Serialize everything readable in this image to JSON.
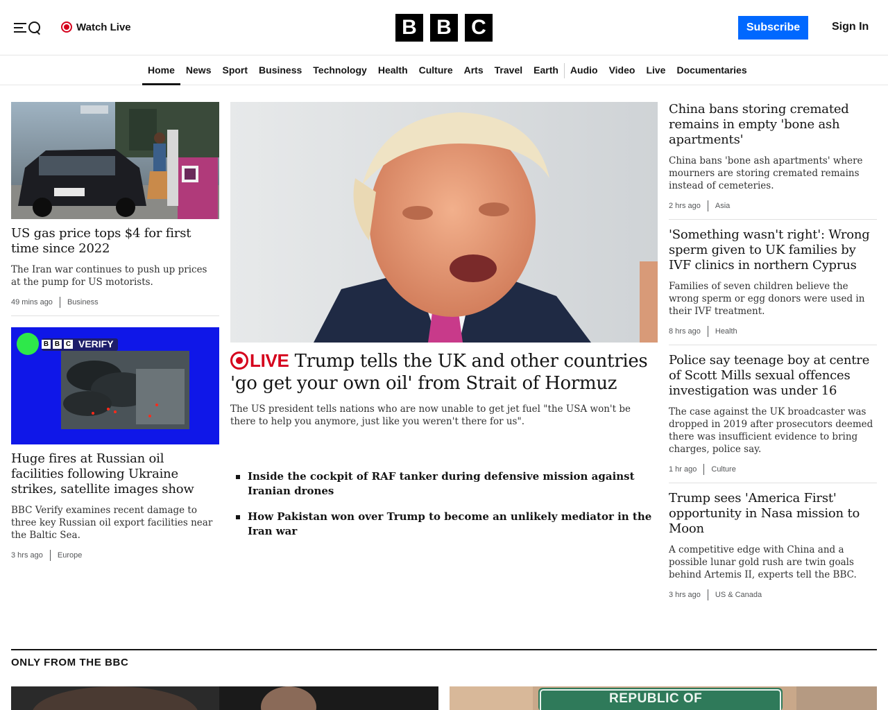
{
  "header": {
    "watch_live": "Watch Live",
    "logo": [
      "B",
      "B",
      "C"
    ],
    "subscribe": "Subscribe",
    "sign_in": "Sign In",
    "accent": "#0068ff",
    "live_color": "#d5001c"
  },
  "nav": {
    "items": [
      "Home",
      "News",
      "Sport",
      "Business",
      "Technology",
      "Health",
      "Culture",
      "Arts",
      "Travel",
      "Earth",
      "Audio",
      "Video",
      "Live",
      "Documentaries"
    ],
    "active": "Home"
  },
  "left": [
    {
      "title": "US gas price tops $4 for first time since 2022",
      "desc": "The Iran war continues to push up prices at the pump for US motorists.",
      "time": "49 mins ago",
      "tag": "Business"
    },
    {
      "title": "Huge fires at Russian oil facilities following Ukraine strikes, satellite images show",
      "desc": "BBC Verify examines recent damage to three key Russian oil export facilities near the Baltic Sea.",
      "time": "3 hrs ago",
      "tag": "Europe",
      "badge": "VERIFY"
    }
  ],
  "hero": {
    "live_label": "LIVE",
    "title": "Trump tells the UK and other countries 'go get your own oil' from Strait of Hormuz",
    "desc": "The US president tells nations who are now unable to get jet fuel \"the USA won't be there to help you anymore, just like you weren't there for us\".",
    "related": [
      "Inside the cockpit of RAF tanker during defensive mission against Iranian drones",
      "How Pakistan won over Trump to become an unlikely mediator in the Iran war"
    ]
  },
  "right": [
    {
      "title": "China bans storing cremated remains in empty 'bone ash apartments'",
      "desc": "China bans 'bone ash apartments' where mourners are storing cremated remains instead of cemeteries.",
      "time": "2 hrs ago",
      "tag": "Asia"
    },
    {
      "title": "'Something wasn't right': Wrong sperm given to UK families by IVF clinics in northern Cyprus",
      "desc": "Families of seven children believe the wrong sperm or egg donors were used in their IVF treatment.",
      "time": "8 hrs ago",
      "tag": "Health"
    },
    {
      "title": "Police say teenage boy at centre of Scott Mills sexual offences investigation was under 16",
      "desc": "The case against the UK broadcaster was dropped in 2019 after prosecutors deemed there was insufficient evidence to bring charges, police say.",
      "time": "1 hr ago",
      "tag": "Culture"
    },
    {
      "title": "Trump sees 'America First' opportunity in Nasa mission to Moon",
      "desc": "A competitive edge with China and a possible lunar gold rush are twin goals behind Artemis II, experts tell the BBC.",
      "time": "3 hrs ago",
      "tag": "US & Canada"
    }
  ],
  "section": {
    "title": "ONLY FROM THE BBC",
    "sign_text": "REPUBLIC OF"
  }
}
